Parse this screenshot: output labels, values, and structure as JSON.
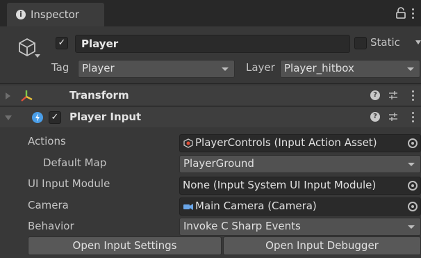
{
  "tab": {
    "icon": "info-icon",
    "label": "Inspector"
  },
  "gameobject": {
    "active": true,
    "name": "Player",
    "static_label": "Static",
    "static": false,
    "tag_label": "Tag",
    "tag_value": "Player",
    "layer_label": "Layer",
    "layer_value": "Player_hitbox"
  },
  "transform": {
    "title": "Transform",
    "expanded": false
  },
  "player_input": {
    "title": "Player Input",
    "enabled": true,
    "expanded": true,
    "properties": {
      "actions": {
        "label": "Actions",
        "value": "PlayerControls (Input Action Asset)"
      },
      "default_map": {
        "label": "Default Map",
        "value": "PlayerGround"
      },
      "ui_input_module": {
        "label": "UI Input Module",
        "value": "None (Input System UI Input Module)"
      },
      "camera": {
        "label": "Camera",
        "value": "Main Camera (Camera)"
      },
      "behavior": {
        "label": "Behavior",
        "value": "Invoke C Sharp Events"
      }
    },
    "buttons": {
      "open_settings": "Open Input Settings",
      "open_debugger": "Open Input Debugger"
    }
  },
  "colors": {
    "background": "#383838",
    "tab_bar": "#282828",
    "field": "#2a2a2a",
    "dropdown": "#515151",
    "button": "#585858",
    "transform_icon_red": "#e0513a",
    "transform_icon_yellow": "#e8c23a",
    "transform_icon_green": "#7ec94a",
    "player_input_icon": "#4a9ee8",
    "camera_icon": "#6aa6e8"
  }
}
